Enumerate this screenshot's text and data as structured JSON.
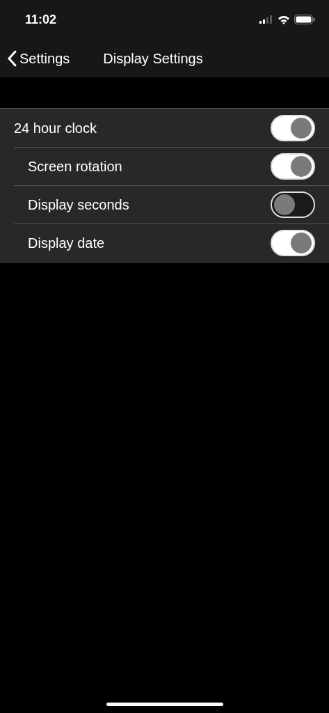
{
  "status_bar": {
    "time": "11:02"
  },
  "nav": {
    "back_label": "Settings",
    "title": "Display Settings"
  },
  "settings": [
    {
      "label": "24 hour clock",
      "on": true
    },
    {
      "label": "Screen rotation",
      "on": true
    },
    {
      "label": "Display seconds",
      "on": false
    },
    {
      "label": "Display date",
      "on": true
    }
  ]
}
